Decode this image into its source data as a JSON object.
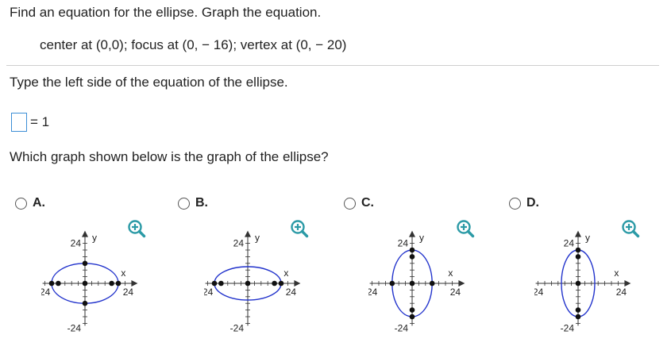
{
  "question": {
    "title": "Find an equation for the ellipse.  Graph the equation.",
    "given": "center at (0,0); focus at (0, − 16); vertex at (0, − 20)",
    "part1": "Type the left side of the equation of the ellipse.",
    "equation_rhs": "= 1",
    "answer_value": "",
    "part2": "Which graph shown below is the graph of the ellipse?"
  },
  "colors": {
    "ellipse": "#2233cc",
    "axes": "#333333",
    "points": "#111111",
    "input_border": "#3d8fd6",
    "zoom_icon": "#2b9aa6"
  },
  "graph_labels": {
    "y_axis": "y",
    "x_axis": "x",
    "pos": "24",
    "neg": "-24"
  },
  "options": [
    {
      "letter": "A.",
      "selected": false,
      "chart_data": {
        "type": "scatter",
        "xlim": [
          -24,
          24
        ],
        "ylim": [
          -24,
          24
        ],
        "ellipse": {
          "center": [
            0,
            0
          ],
          "semi_x": 20,
          "semi_y": 12
        },
        "points": [
          [
            -20,
            0
          ],
          [
            20,
            0
          ],
          [
            -16,
            0
          ],
          [
            16,
            0
          ],
          [
            0,
            12
          ],
          [
            0,
            -12
          ],
          [
            0,
            0
          ]
        ]
      }
    },
    {
      "letter": "B.",
      "selected": false,
      "chart_data": {
        "type": "scatter",
        "xlim": [
          -24,
          24
        ],
        "ylim": [
          -24,
          24
        ],
        "ellipse": {
          "center": [
            0,
            0
          ],
          "semi_x": 20,
          "semi_y": 10
        },
        "points": [
          [
            -20,
            0
          ],
          [
            20,
            0
          ],
          [
            -16,
            0
          ],
          [
            16,
            0
          ],
          [
            0,
            0
          ]
        ]
      }
    },
    {
      "letter": "C.",
      "selected": false,
      "chart_data": {
        "type": "scatter",
        "xlim": [
          -24,
          24
        ],
        "ylim": [
          -24,
          24
        ],
        "ellipse": {
          "center": [
            0,
            0
          ],
          "semi_x": 12,
          "semi_y": 20
        },
        "points": [
          [
            -12,
            0
          ],
          [
            12,
            0
          ],
          [
            0,
            20
          ],
          [
            0,
            -20
          ],
          [
            0,
            16
          ],
          [
            0,
            -16
          ],
          [
            0,
            0
          ]
        ]
      }
    },
    {
      "letter": "D.",
      "selected": false,
      "chart_data": {
        "type": "scatter",
        "xlim": [
          -24,
          24
        ],
        "ylim": [
          -24,
          24
        ],
        "ellipse": {
          "center": [
            0,
            0
          ],
          "semi_x": 10,
          "semi_y": 20
        },
        "points": [
          [
            0,
            20
          ],
          [
            0,
            -20
          ],
          [
            0,
            16
          ],
          [
            0,
            -16
          ],
          [
            0,
            0
          ]
        ]
      }
    }
  ]
}
